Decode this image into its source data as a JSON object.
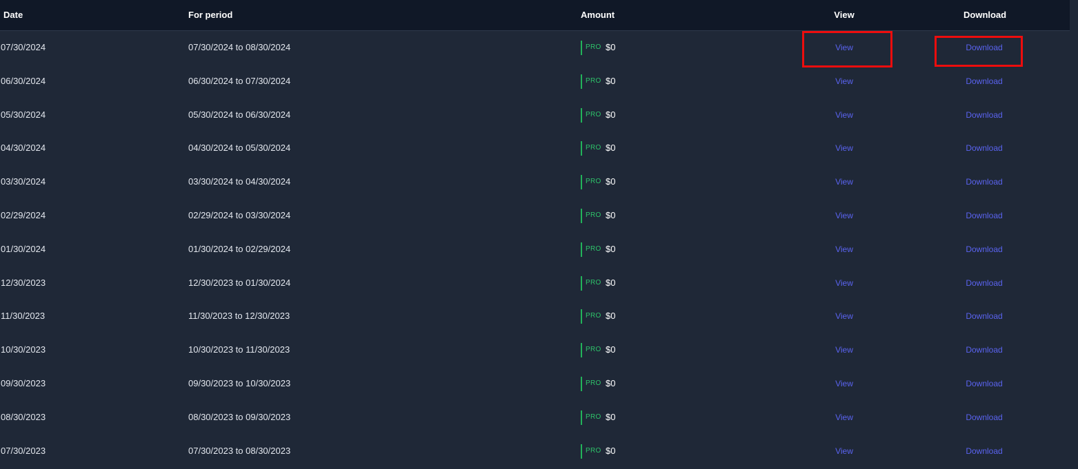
{
  "columns": {
    "date": "Date",
    "period": "For period",
    "amount": "Amount",
    "view": "View",
    "download": "Download"
  },
  "colors": {
    "header_bg": "#101827",
    "body_bg": "#1f2837",
    "link": "#5a63f0",
    "plan_accent": "#22b35a",
    "highlight": "#ee0d0d"
  },
  "rows": [
    {
      "date": "07/30/2024",
      "period": "07/30/2024 to 08/30/2024",
      "plan": "PRO",
      "amount": "$0",
      "view": "View",
      "download": "Download"
    },
    {
      "date": "06/30/2024",
      "period": "06/30/2024 to 07/30/2024",
      "plan": "PRO",
      "amount": "$0",
      "view": "View",
      "download": "Download"
    },
    {
      "date": "05/30/2024",
      "period": "05/30/2024 to 06/30/2024",
      "plan": "PRO",
      "amount": "$0",
      "view": "View",
      "download": "Download"
    },
    {
      "date": "04/30/2024",
      "period": "04/30/2024 to 05/30/2024",
      "plan": "PRO",
      "amount": "$0",
      "view": "View",
      "download": "Download"
    },
    {
      "date": "03/30/2024",
      "period": "03/30/2024 to 04/30/2024",
      "plan": "PRO",
      "amount": "$0",
      "view": "View",
      "download": "Download"
    },
    {
      "date": "02/29/2024",
      "period": "02/29/2024 to 03/30/2024",
      "plan": "PRO",
      "amount": "$0",
      "view": "View",
      "download": "Download"
    },
    {
      "date": "01/30/2024",
      "period": "01/30/2024 to 02/29/2024",
      "plan": "PRO",
      "amount": "$0",
      "view": "View",
      "download": "Download"
    },
    {
      "date": "12/30/2023",
      "period": "12/30/2023 to 01/30/2024",
      "plan": "PRO",
      "amount": "$0",
      "view": "View",
      "download": "Download"
    },
    {
      "date": "11/30/2023",
      "period": "11/30/2023 to 12/30/2023",
      "plan": "PRO",
      "amount": "$0",
      "view": "View",
      "download": "Download"
    },
    {
      "date": "10/30/2023",
      "period": "10/30/2023 to 11/30/2023",
      "plan": "PRO",
      "amount": "$0",
      "view": "View",
      "download": "Download"
    },
    {
      "date": "09/30/2023",
      "period": "09/30/2023 to 10/30/2023",
      "plan": "PRO",
      "amount": "$0",
      "view": "View",
      "download": "Download"
    },
    {
      "date": "08/30/2023",
      "period": "08/30/2023 to 09/30/2023",
      "plan": "PRO",
      "amount": "$0",
      "view": "View",
      "download": "Download"
    },
    {
      "date": "07/30/2023",
      "period": "07/30/2023 to 08/30/2023",
      "plan": "PRO",
      "amount": "$0",
      "view": "View",
      "download": "Download"
    }
  ]
}
